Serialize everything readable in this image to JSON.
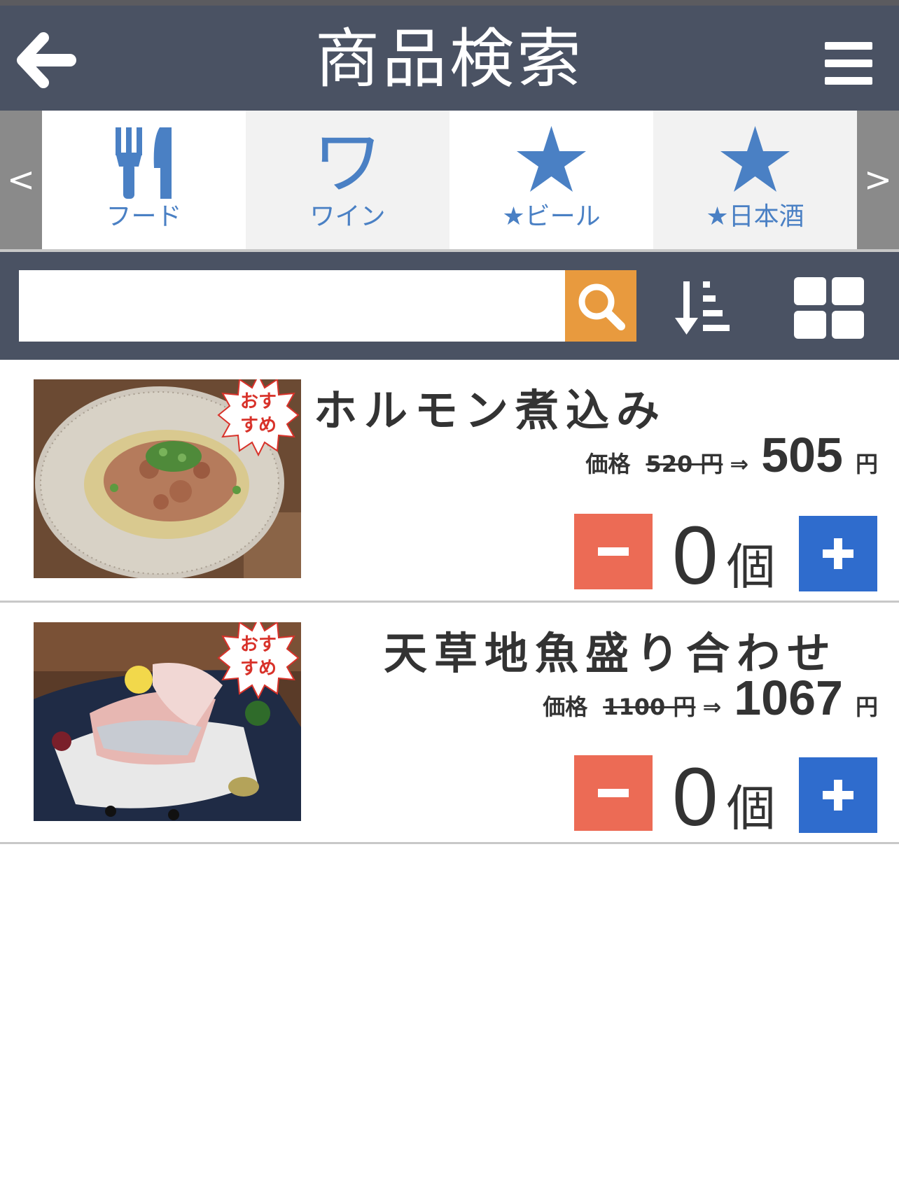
{
  "header": {
    "title": "商品検索"
  },
  "categories": {
    "prev": "<",
    "next": ">",
    "tabs": [
      {
        "label": "フード",
        "icon": "fork-knife-icon",
        "active": true
      },
      {
        "label": "ワイン",
        "icon_text": "ワ",
        "active": false
      },
      {
        "label": "★ビール",
        "icon": "star-icon",
        "active": true
      },
      {
        "label": "★日本酒",
        "icon": "star-icon",
        "active": false
      }
    ]
  },
  "search": {
    "value": "",
    "placeholder": ""
  },
  "items": [
    {
      "name": "ホルモン煮込み",
      "badge": "おすすめ",
      "price_label": "価格",
      "old_price": "520 円",
      "arrow": "⇒",
      "new_price": "505",
      "yen": "円",
      "quantity": "0",
      "unit": "個"
    },
    {
      "name": "天草地魚盛り合わせ",
      "badge": "おすすめ",
      "price_label": "価格",
      "old_price": "1100 円",
      "arrow": "⇒",
      "new_price": "1067",
      "yen": "円",
      "quantity": "0",
      "unit": "個"
    }
  ],
  "colors": {
    "header": "#4a5263",
    "accent": "#4a80c4",
    "search": "#e89a3e",
    "minus": "#ec6b55",
    "plus": "#2f6ccd"
  }
}
